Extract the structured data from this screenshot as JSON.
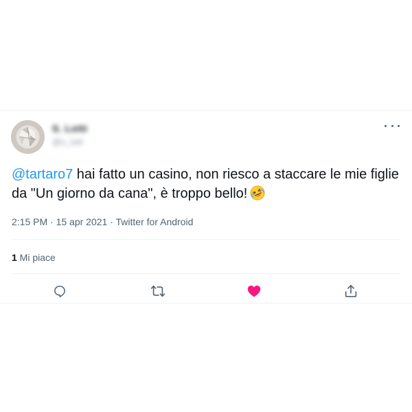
{
  "tweet": {
    "display_name": "S. Lotti",
    "handle": "@s_lott",
    "mention": "@tartaro7",
    "text": " hai fatto un casino, non riesco a staccare le mie figlie da \"Un giorno da cana\", è troppo bello!",
    "emoji": "rolling-on-floor-laughing-emoji",
    "time": "2:15 PM",
    "separator": " · ",
    "date": "15 apr 2021",
    "source": "Twitter for Android",
    "likes_count": "1",
    "likes_label": " Mi piace"
  },
  "actions": [
    {
      "name": "reply",
      "icon": "reply-icon"
    },
    {
      "name": "retweet",
      "icon": "retweet-icon"
    },
    {
      "name": "like",
      "icon": "heart-icon",
      "active": true
    },
    {
      "name": "share",
      "icon": "share-icon"
    }
  ],
  "colors": {
    "accent": "#1d9bf0",
    "like": "#f91880",
    "muted": "#536471",
    "text": "#0f1419"
  }
}
